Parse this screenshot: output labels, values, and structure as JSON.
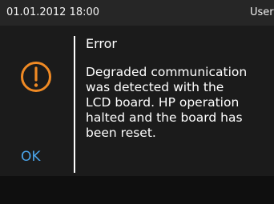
{
  "status_bar": {
    "datetime": "01.01.2012 18:00",
    "user": "User A"
  },
  "dialog": {
    "icon": "exclamation-circle-icon",
    "icon_color": "#f08a24",
    "title": "Error",
    "message_lines": [
      "Degraded communication",
      "was detected with the",
      "LCD board. HP operation",
      "halted and the board has",
      "been reset."
    ],
    "ok_label": "OK",
    "ok_color": "#4aa3e8"
  }
}
